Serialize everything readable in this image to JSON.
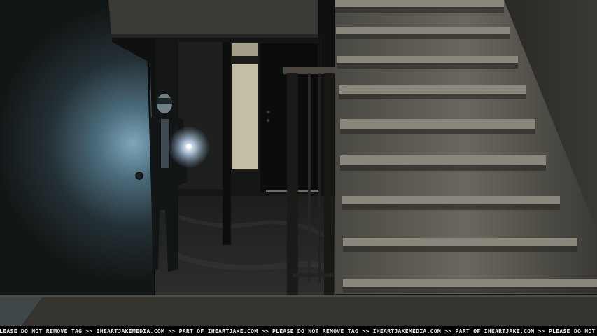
{
  "watermark": {
    "text": "PLEASE DO NOT REMOVE TAG >> IHEARTJAKEMEDIA.COM >> PART OF IHEARTJAKE.COM >> PLEASE DO NOT REMOVE TAG >> IHEARTJAKEMEDIA.COM >> PART OF IHEARTJAKE.COM >> PLEASE DO NOT REMOVE TAG >> IHEARTJAKEMEDIA.COM"
  },
  "colors": {
    "wall_light": "#4a6a7a",
    "wall_dark": "#1a1e1f",
    "stairs": "#6e6b62",
    "stairs_shadow": "#3a3833",
    "door_glow": "#c9c2a8",
    "flashlight": "#ffffff"
  }
}
